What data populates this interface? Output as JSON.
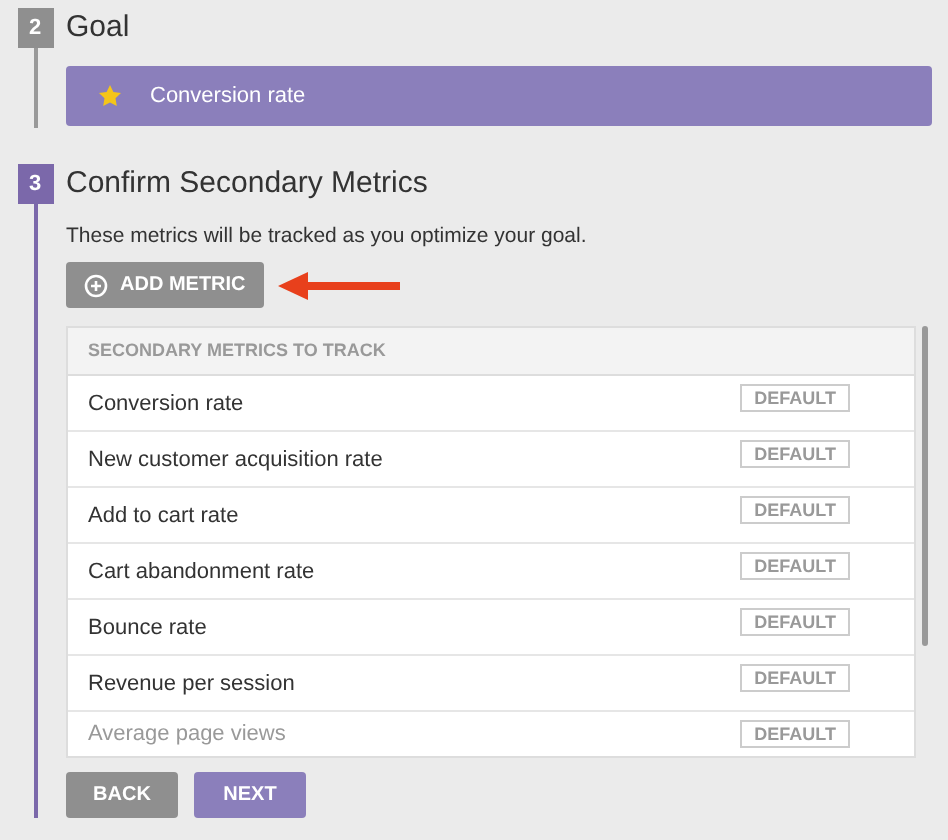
{
  "goal_step": {
    "number": "2",
    "title": "Goal",
    "active": false,
    "goal": "Conversion rate"
  },
  "metrics_step": {
    "number": "3",
    "title": "Confirm Secondary Metrics",
    "active": true,
    "description": "These metrics will be tracked as you optimize your goal.",
    "add_button": "ADD METRIC",
    "table": {
      "header": "SECONDARY METRICS TO TRACK",
      "rows": [
        {
          "name": "Conversion rate",
          "tag": "DEFAULT"
        },
        {
          "name": "New customer acquisition rate",
          "tag": "DEFAULT"
        },
        {
          "name": "Add to cart rate",
          "tag": "DEFAULT"
        },
        {
          "name": "Cart abandonment rate",
          "tag": "DEFAULT"
        },
        {
          "name": "Bounce rate",
          "tag": "DEFAULT"
        },
        {
          "name": "Revenue per session",
          "tag": "DEFAULT"
        },
        {
          "name": "Average page views",
          "tag": "DEFAULT"
        }
      ]
    }
  },
  "buttons": [
    {
      "label": "BACK",
      "kind": "secondary"
    },
    {
      "label": "NEXT",
      "kind": "primary"
    }
  ]
}
